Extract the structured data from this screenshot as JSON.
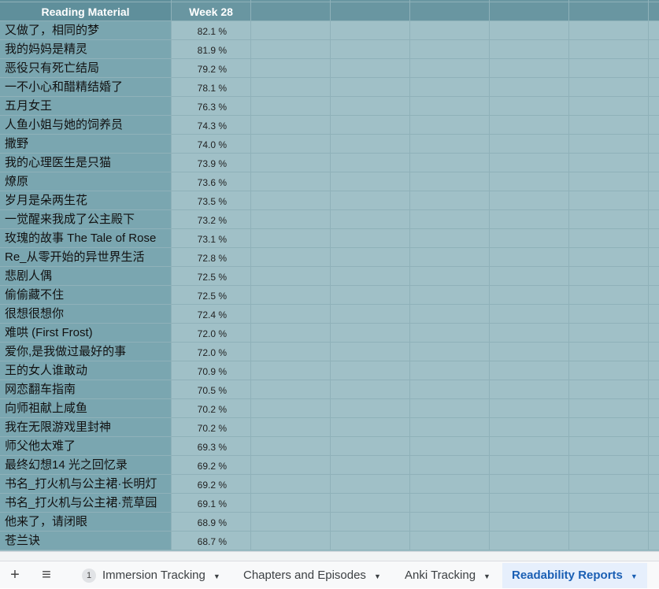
{
  "header": {
    "col_a": "Reading Material",
    "col_b": "Week 28"
  },
  "rows": [
    {
      "title": "又做了，相同的梦",
      "pct": "82.1 %"
    },
    {
      "title": "我的妈妈是精灵",
      "pct": "81.9 %"
    },
    {
      "title": "恶役只有死亡结局",
      "pct": "79.2 %"
    },
    {
      "title": "一不小心和醋精结婚了",
      "pct": "78.1 %"
    },
    {
      "title": "五月女王",
      "pct": "76.3 %"
    },
    {
      "title": "人鱼小姐与她的饲养员",
      "pct": "74.3 %"
    },
    {
      "title": "撒野",
      "pct": "74.0 %"
    },
    {
      "title": "我的心理医生是只猫",
      "pct": "73.9 %"
    },
    {
      "title": "燎原",
      "pct": "73.6 %"
    },
    {
      "title": "岁月是朵两生花",
      "pct": "73.5 %"
    },
    {
      "title": "一觉醒来我成了公主殿下",
      "pct": "73.2 %"
    },
    {
      "title": "玫瑰的故事 The Tale of Rose",
      "pct": "73.1 %"
    },
    {
      "title": "Re_从零开始的异世界生活",
      "pct": "72.8 %"
    },
    {
      "title": "悲剧人偶",
      "pct": "72.5 %"
    },
    {
      "title": "偷偷藏不住",
      "pct": "72.5 %"
    },
    {
      "title": "很想很想你",
      "pct": "72.4 %"
    },
    {
      "title": "难哄 (First Frost)",
      "pct": "72.0 %"
    },
    {
      "title": "爱你,是我做过最好的事",
      "pct": "72.0 %"
    },
    {
      "title": "王的女人谁敢动",
      "pct": "70.9 %"
    },
    {
      "title": "网恋翻车指南",
      "pct": "70.5 %"
    },
    {
      "title": "向师祖献上咸鱼",
      "pct": "70.2 %"
    },
    {
      "title": "我在无限游戏里封神",
      "pct": "70.2 %"
    },
    {
      "title": "师父他太难了",
      "pct": "69.3 %"
    },
    {
      "title": "最终幻想14 光之回忆录",
      "pct": "69.2 %"
    },
    {
      "title": "书名_打火机与公主裙·长明灯",
      "pct": "69.2 %"
    },
    {
      "title": "书名_打火机与公主裙·荒草园",
      "pct": "69.1 %"
    },
    {
      "title": "他来了，请闭眼",
      "pct": "68.9 %"
    },
    {
      "title": "苍兰诀",
      "pct": "68.7 %"
    }
  ],
  "tabbar": {
    "add_icon": "plus-icon",
    "all_sheets_icon": "menu-icon",
    "tabs": [
      {
        "label": "Immersion Tracking",
        "badge": "1"
      },
      {
        "label": "Chapters and Episodes"
      },
      {
        "label": "Anki Tracking"
      },
      {
        "label": "Readability Reports",
        "active": true
      }
    ],
    "add_glyph": "+",
    "menu_glyph": "≡",
    "arrow_glyph": "▼"
  },
  "colors": {
    "grid_bg": "#a0c0c7",
    "first_col": "#7aa6b0",
    "header": "#6996a1",
    "active_tab": "#1a5fb4"
  }
}
